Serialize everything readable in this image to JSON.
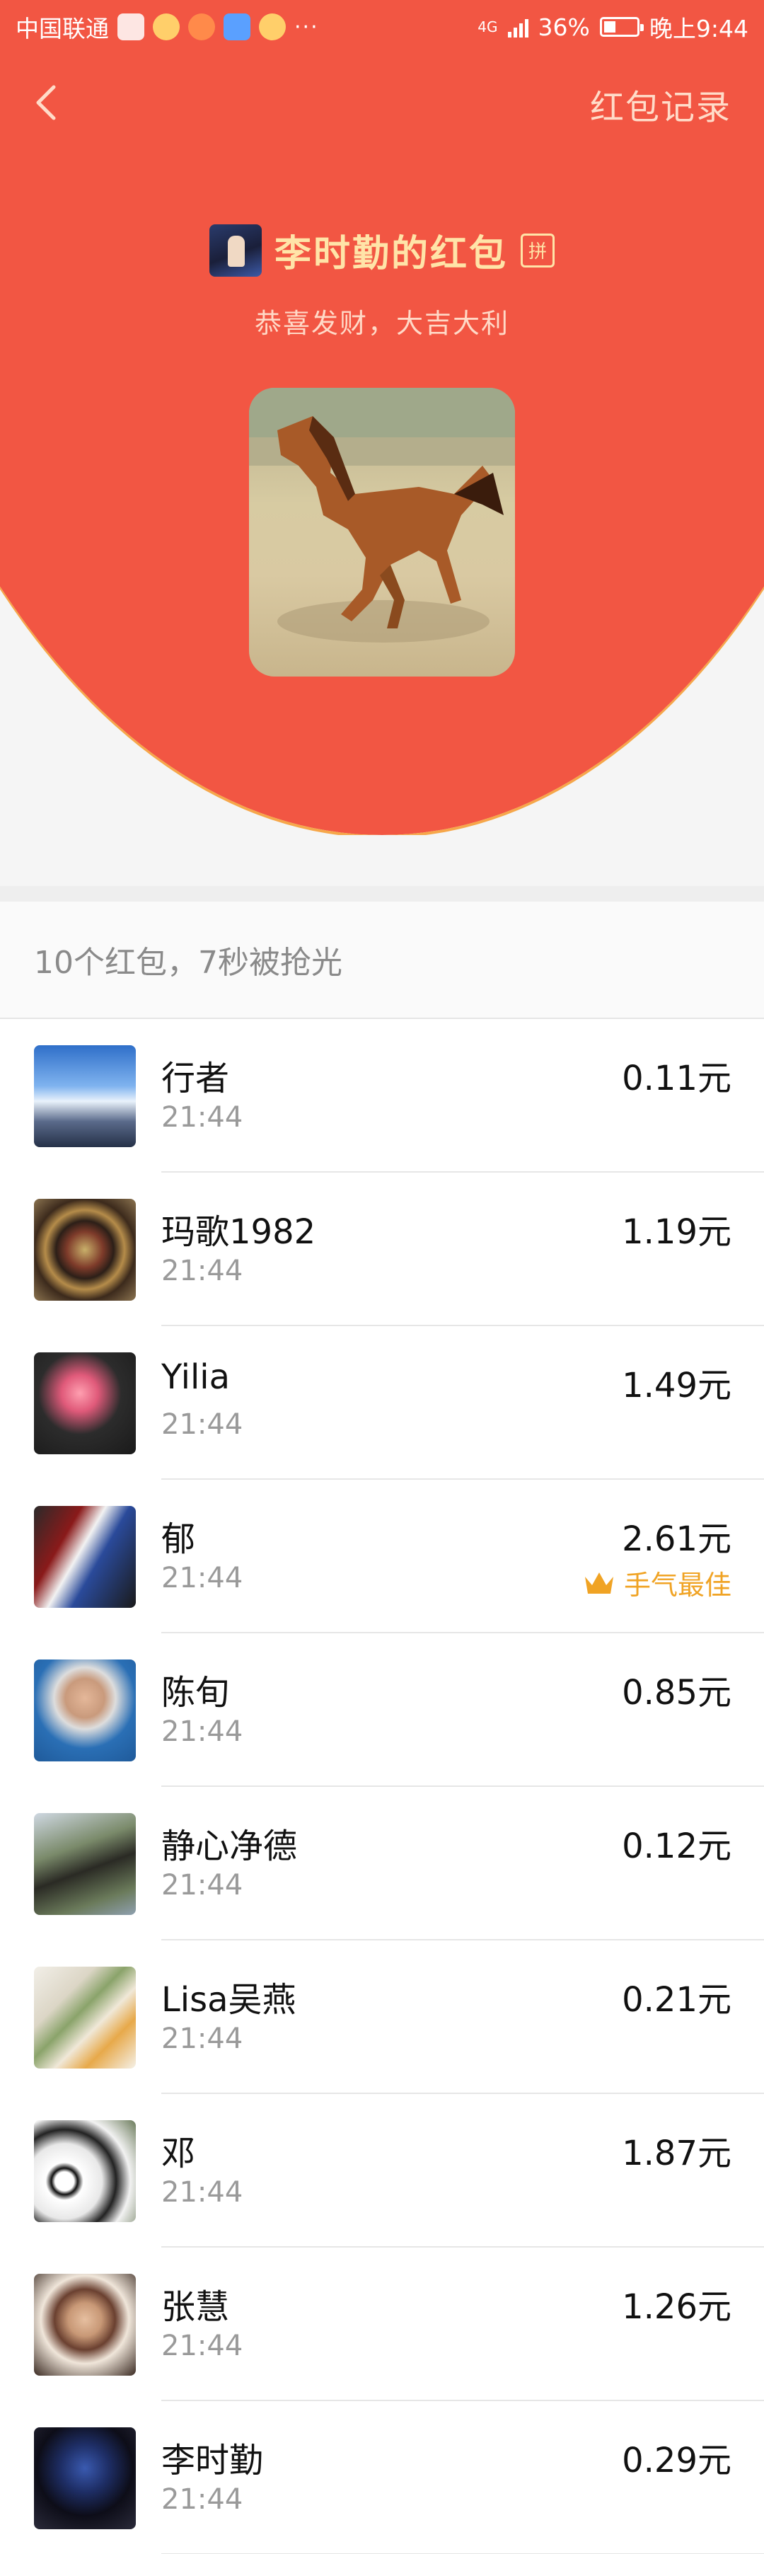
{
  "status_bar": {
    "carrier": "中国联通",
    "more": "···",
    "network": "4G",
    "battery_percent": "36%",
    "battery_level": 0.36,
    "time": "晚上9:44"
  },
  "nav": {
    "back_icon": "chevron-left-icon",
    "records_label": "红包记录"
  },
  "packet": {
    "sender_name": "李时勤的红包",
    "pin_badge": "拼",
    "blessing": "恭喜发财，大吉大利",
    "cover_image": "horse-photo"
  },
  "summary": "10个红包，7秒被抢光",
  "best_luck_label": "手气最佳",
  "colors": {
    "header_red": "#f25643",
    "gold_text": "#ffe4a8",
    "best_luck": "#f0a324"
  },
  "recipients": [
    {
      "name": "行者",
      "time": "21:44",
      "amount": "0.11元",
      "avatar": "sky-landscape"
    },
    {
      "name": "玛歌1982",
      "time": "21:44",
      "amount": "1.19元",
      "avatar": "mandala"
    },
    {
      "name": "Yilia",
      "time": "21:44",
      "amount": "1.49元",
      "avatar": "pink-flowers"
    },
    {
      "name": "郁",
      "time": "21:44",
      "amount": "2.61元",
      "avatar": "sports-photo",
      "best": true
    },
    {
      "name": "陈旬",
      "time": "21:44",
      "amount": "0.85元",
      "avatar": "man-portrait"
    },
    {
      "name": "静心净德",
      "time": "21:44",
      "amount": "0.12元",
      "avatar": "rock-landscape"
    },
    {
      "name": "Lisa吴燕",
      "time": "21:44",
      "amount": "0.21元",
      "avatar": "bamboo-painting"
    },
    {
      "name": "邓",
      "time": "21:44",
      "amount": "1.87元",
      "avatar": "pandas"
    },
    {
      "name": "张慧",
      "time": "21:44",
      "amount": "1.26元",
      "avatar": "person-portrait"
    },
    {
      "name": "李时勤",
      "time": "21:44",
      "amount": "0.29元",
      "avatar": "dark-photo"
    }
  ]
}
